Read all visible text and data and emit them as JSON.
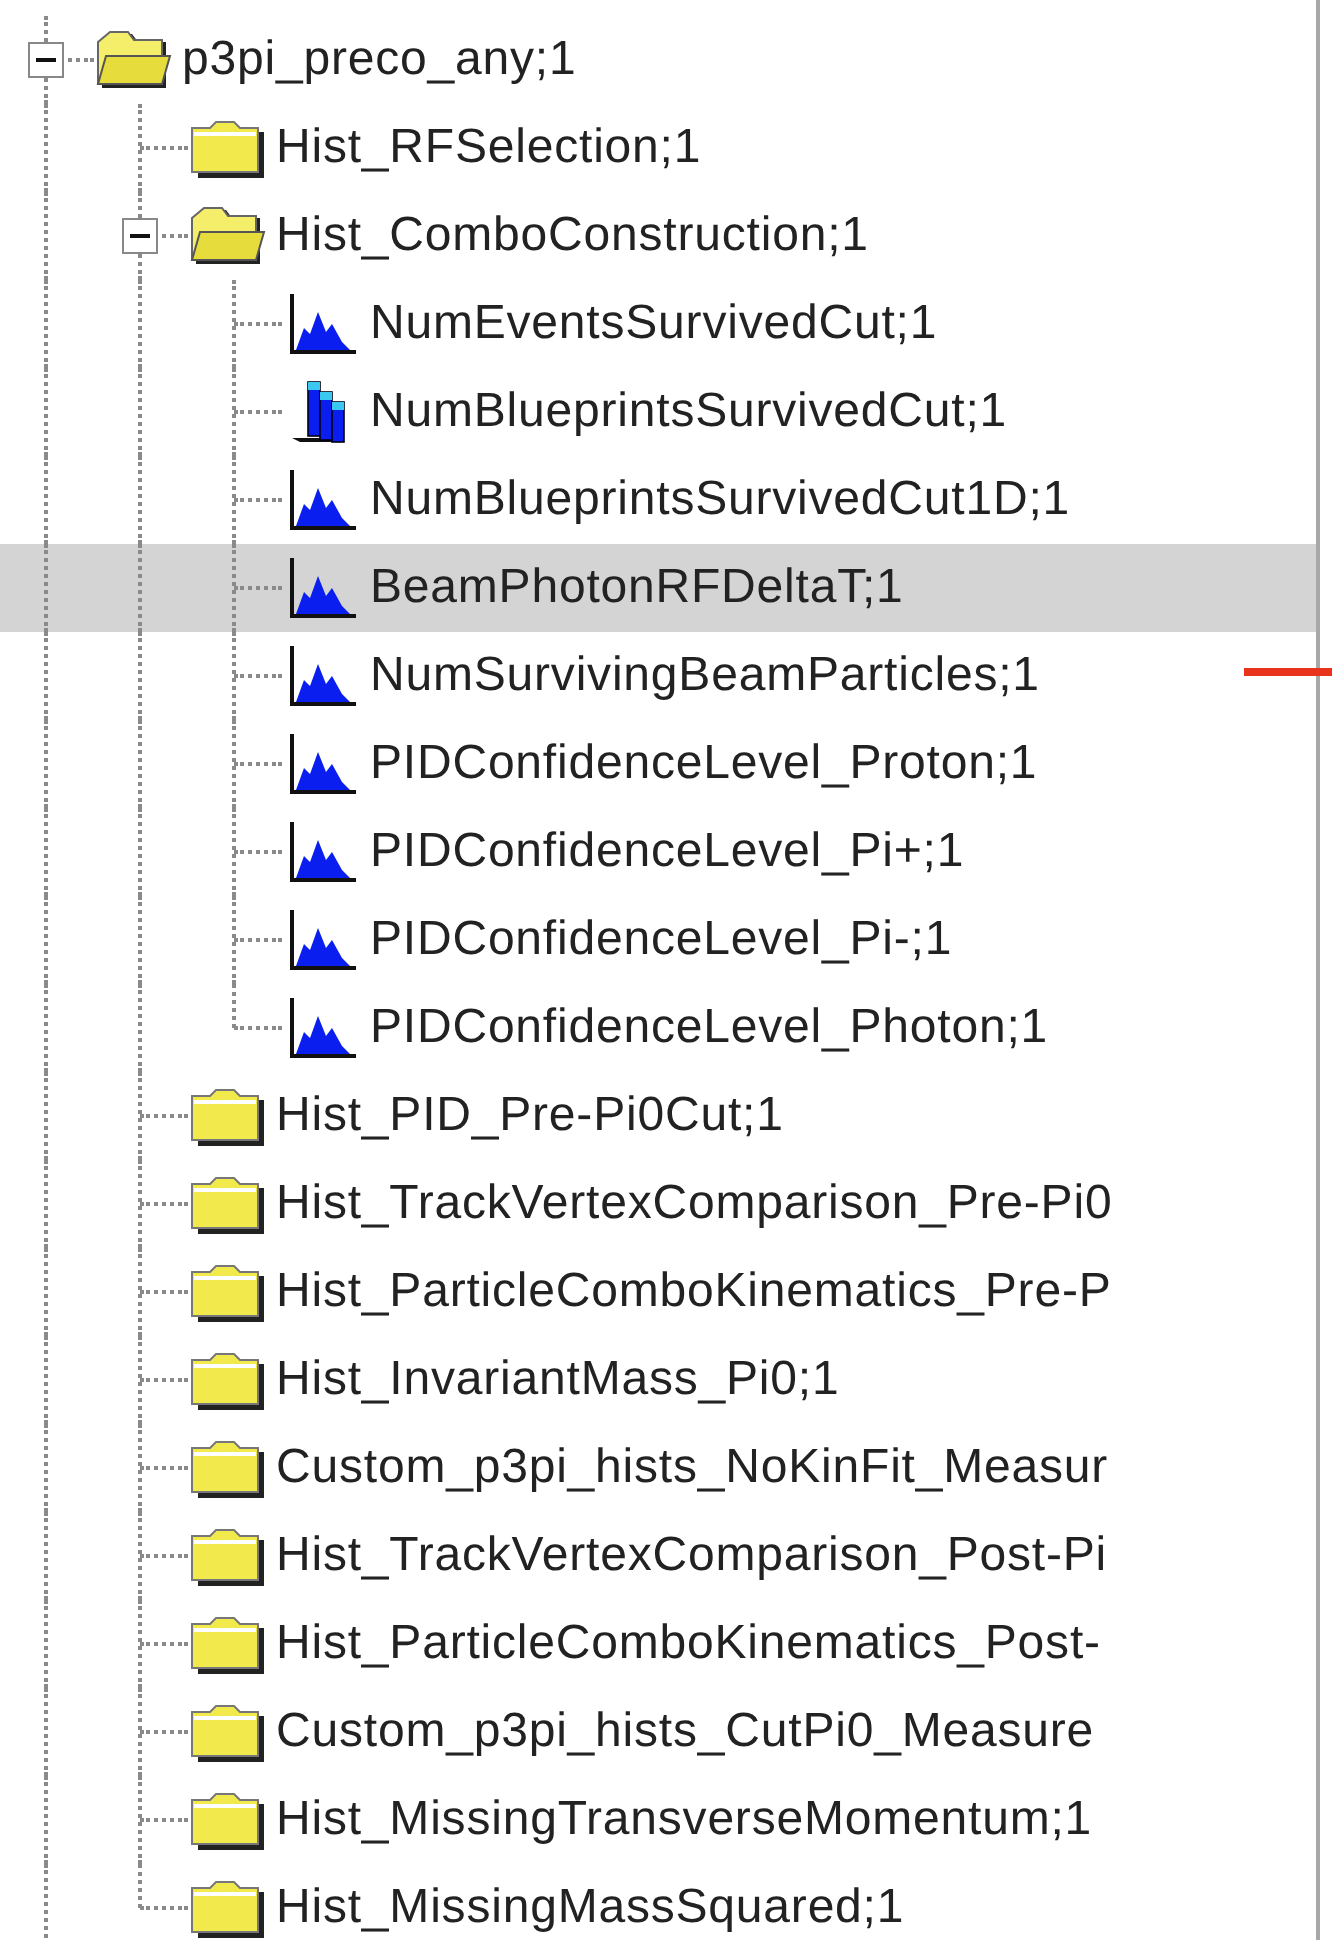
{
  "tree": [
    {
      "label": "p3pi_preco_any;1",
      "kind": "folder",
      "expanded": true,
      "selected": false,
      "children": [
        {
          "label": "Hist_RFSelection;1",
          "kind": "folder",
          "expanded": false,
          "selected": false
        },
        {
          "label": "Hist_ComboConstruction;1",
          "kind": "folder",
          "expanded": true,
          "selected": false,
          "children": [
            {
              "label": "NumEventsSurvivedCut;1",
              "kind": "hist1d",
              "selected": false
            },
            {
              "label": "NumBlueprintsSurvivedCut;1",
              "kind": "hist2d",
              "selected": false
            },
            {
              "label": "NumBlueprintsSurvivedCut1D;1",
              "kind": "hist1d",
              "selected": false
            },
            {
              "label": "BeamPhotonRFDeltaT;1",
              "kind": "hist1d",
              "selected": true
            },
            {
              "label": "NumSurvivingBeamParticles;1",
              "kind": "hist1d",
              "selected": false
            },
            {
              "label": "PIDConfidenceLevel_Proton;1",
              "kind": "hist1d",
              "selected": false
            },
            {
              "label": "PIDConfidenceLevel_Pi+;1",
              "kind": "hist1d",
              "selected": false
            },
            {
              "label": "PIDConfidenceLevel_Pi-;1",
              "kind": "hist1d",
              "selected": false
            },
            {
              "label": "PIDConfidenceLevel_Photon;1",
              "kind": "hist1d",
              "selected": false
            }
          ]
        },
        {
          "label": "Hist_PID_Pre-Pi0Cut;1",
          "kind": "folder",
          "expanded": false,
          "selected": false
        },
        {
          "label": "Hist_TrackVertexComparison_Pre-Pi0",
          "kind": "folder",
          "expanded": false,
          "selected": false
        },
        {
          "label": "Hist_ParticleComboKinematics_Pre-P",
          "kind": "folder",
          "expanded": false,
          "selected": false
        },
        {
          "label": "Hist_InvariantMass_Pi0;1",
          "kind": "folder",
          "expanded": false,
          "selected": false
        },
        {
          "label": "Custom_p3pi_hists_NoKinFit_Measur",
          "kind": "folder",
          "expanded": false,
          "selected": false
        },
        {
          "label": "Hist_TrackVertexComparison_Post-Pi",
          "kind": "folder",
          "expanded": false,
          "selected": false
        },
        {
          "label": "Hist_ParticleComboKinematics_Post-",
          "kind": "folder",
          "expanded": false,
          "selected": false
        },
        {
          "label": "Custom_p3pi_hists_CutPi0_Measure",
          "kind": "folder",
          "expanded": false,
          "selected": false
        },
        {
          "label": "Hist_MissingTransverseMomentum;1",
          "kind": "folder",
          "expanded": false,
          "selected": false
        },
        {
          "label": "Hist_MissingMassSquared;1",
          "kind": "folder",
          "expanded": false,
          "selected": false
        }
      ]
    }
  ]
}
